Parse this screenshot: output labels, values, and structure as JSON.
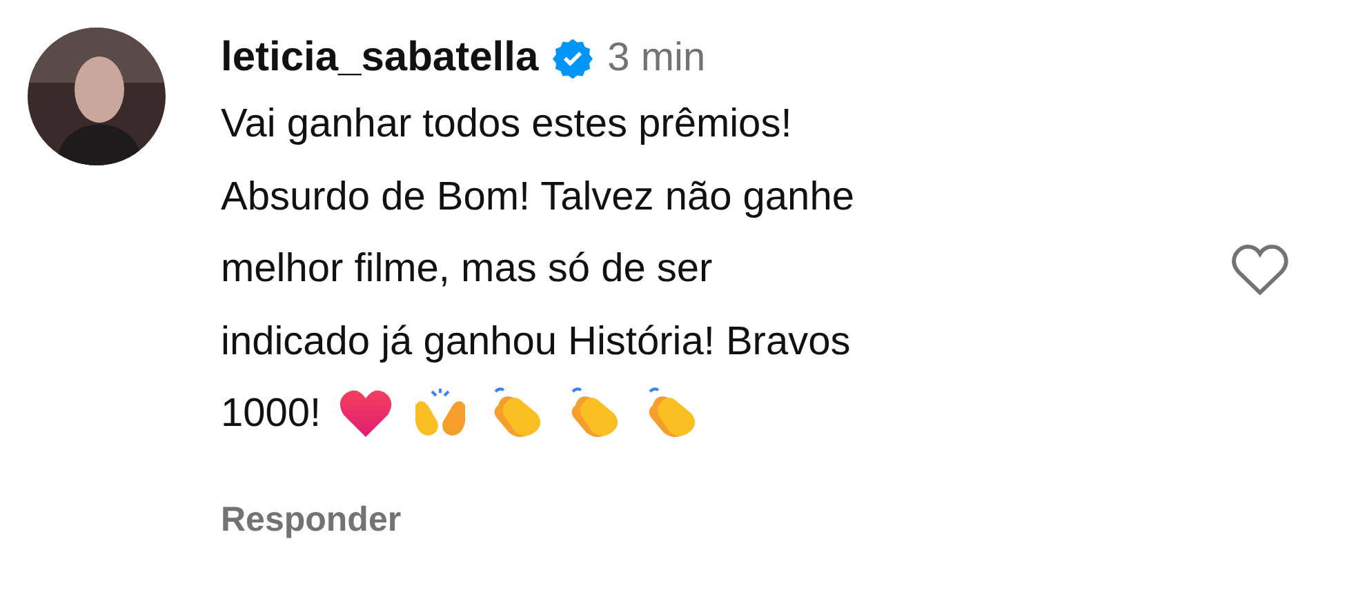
{
  "comment": {
    "username": "leticia_sabatella",
    "verified": true,
    "time": "3 min",
    "lines": [
      "Vai ganhar todos estes prêmios!",
      "Absurdo de Bom! Talvez não ganhe",
      "melhor filme, mas só de ser",
      "indicado já ganhou História! Bravos",
      "1000!"
    ],
    "liked": false,
    "reply": "Responder"
  }
}
